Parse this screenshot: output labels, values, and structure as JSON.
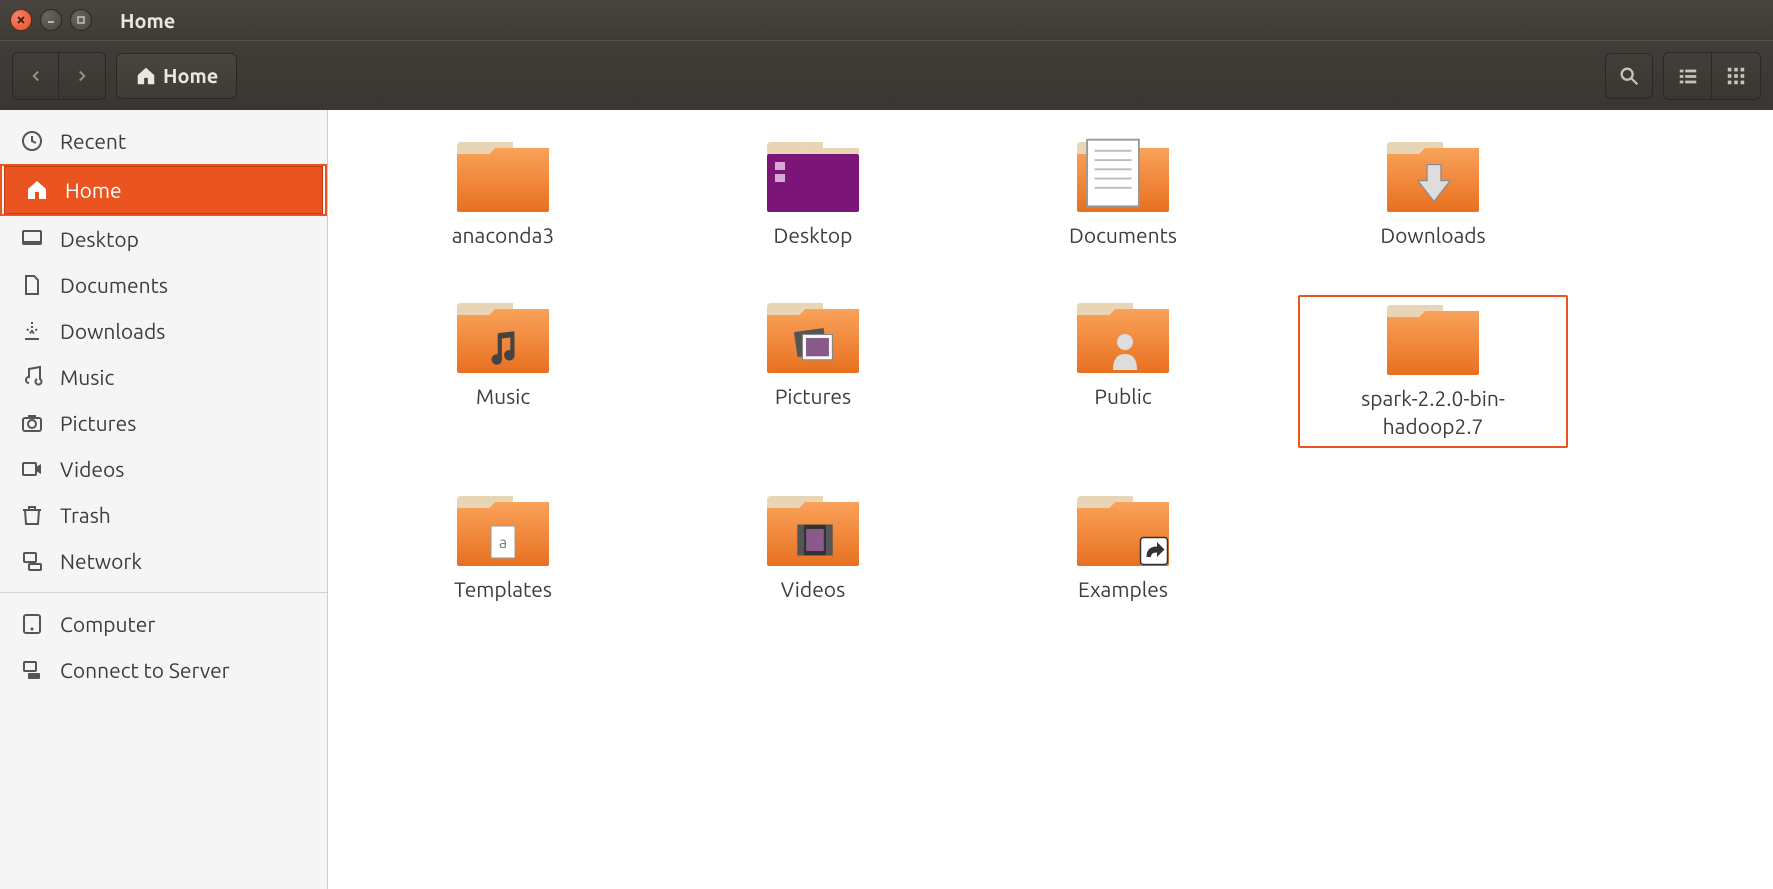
{
  "window": {
    "title": "Home"
  },
  "breadcrumb": {
    "label": "Home"
  },
  "sidebar": {
    "items": [
      {
        "label": "Recent",
        "icon": "clock"
      },
      {
        "label": "Home",
        "icon": "home",
        "active": true
      },
      {
        "label": "Desktop",
        "icon": "desktop"
      },
      {
        "label": "Documents",
        "icon": "document"
      },
      {
        "label": "Downloads",
        "icon": "download"
      },
      {
        "label": "Music",
        "icon": "music"
      },
      {
        "label": "Pictures",
        "icon": "camera"
      },
      {
        "label": "Videos",
        "icon": "video"
      },
      {
        "label": "Trash",
        "icon": "trash"
      },
      {
        "label": "Network",
        "icon": "network"
      }
    ],
    "items2": [
      {
        "label": "Computer",
        "icon": "computer"
      },
      {
        "label": "Connect to Server",
        "icon": "server"
      }
    ]
  },
  "folders": [
    {
      "label": "anaconda3",
      "type": "plain"
    },
    {
      "label": "Desktop",
      "type": "desktop"
    },
    {
      "label": "Documents",
      "type": "documents"
    },
    {
      "label": "Downloads",
      "type": "downloads"
    },
    {
      "label": "Music",
      "type": "music"
    },
    {
      "label": "Pictures",
      "type": "pictures"
    },
    {
      "label": "Public",
      "type": "public"
    },
    {
      "label": "spark-2.2.0-bin-hadoop2.7",
      "type": "plain",
      "highlighted": true
    },
    {
      "label": "Templates",
      "type": "templates"
    },
    {
      "label": "Videos",
      "type": "videos"
    },
    {
      "label": "Examples",
      "type": "examples"
    }
  ]
}
